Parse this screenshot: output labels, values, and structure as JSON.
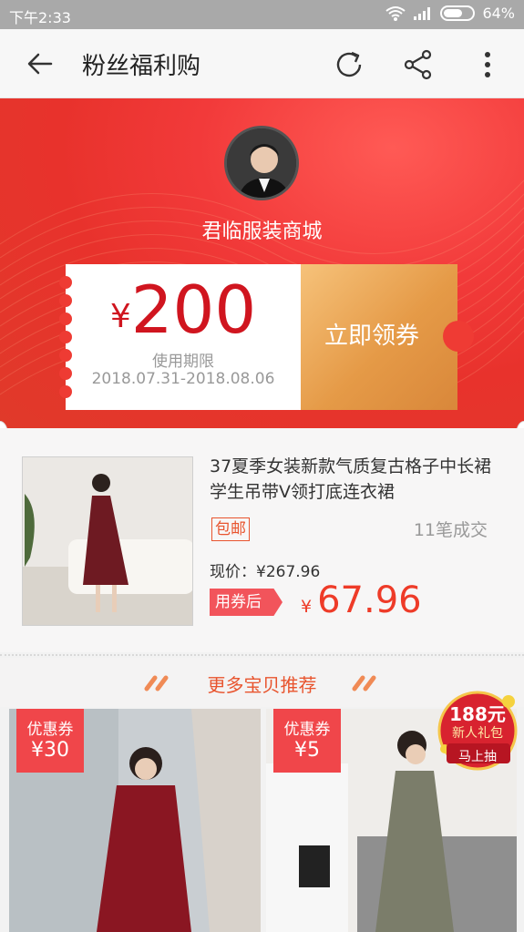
{
  "status_bar": {
    "time": "下午2:33",
    "battery": "64%"
  },
  "navbar": {
    "title": "粉丝福利购"
  },
  "shop": {
    "name": "君临服装商城"
  },
  "coupon": {
    "currency": "¥",
    "amount": "200",
    "validity_label": "使用期限",
    "validity_dates": "2018.07.31-2018.08.06",
    "claim_label": "立即领券"
  },
  "product": {
    "title": "37夏季女装新款气质复古格子中长裙学生吊带V领打底连衣裙",
    "free_shipping": "包邮",
    "sold": "11笔成交",
    "current_price": "现价：¥267.96",
    "after_coupon_label": "用券后",
    "currency": "¥",
    "final_price": "67.96"
  },
  "recommend": {
    "title": "更多宝贝推荐"
  },
  "grid": [
    {
      "badge_label": "优惠券",
      "badge_value": "¥30"
    },
    {
      "badge_label": "优惠券",
      "badge_value": "¥5"
    }
  ],
  "promo": {
    "amount": "188元",
    "subtitle": "新人礼包",
    "cta": "马上抽"
  },
  "colors": {
    "accent_red": "#e8322c",
    "price_red": "#ee3b28",
    "gold": "#e59a47"
  }
}
